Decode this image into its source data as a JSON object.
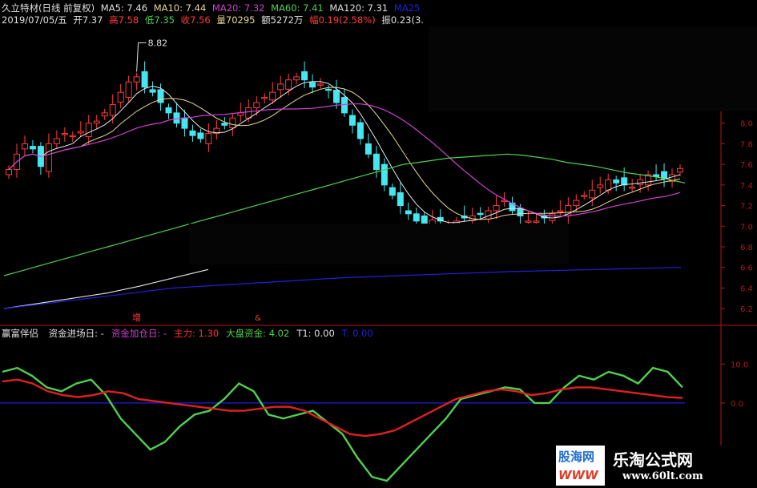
{
  "header": {
    "title": "久立特材(日线 前复权)",
    "ma5": "MA5: 7.46",
    "ma10": "MA10: 7.44",
    "ma20": "MA20: 7.32",
    "ma60": "MA60: 7.41",
    "ma120": "MA120: 7.31",
    "ma250": "MA25",
    "date": "2019/07/05/五",
    "open": "开7.37",
    "high": "高7.58",
    "low": "低7.35",
    "close": "收7.56",
    "volume": "量70295",
    "amount": "额5272万",
    "change": "幅0.19(2.58%)",
    "amplitude": "振0.23(3."
  },
  "colors": {
    "up": "#ff3c3c",
    "down": "#46e6f0",
    "ma5": "#e8e8e8",
    "ma10": "#e8d890",
    "ma20": "#d040d0",
    "ma60": "#50d050",
    "ma120": "#e0e0e0",
    "ma250": "#2020e0",
    "axis": "#b01818"
  },
  "chart_data": [
    {
      "type": "candlestick",
      "title": "久立特材(日线 前复权)",
      "ylim": [
        6.1,
        8.9
      ],
      "yticks": [
        "8.0",
        "7.8",
        "7.6",
        "7.4",
        "7.2",
        "7.0",
        "6.8",
        "6.6",
        "6.4",
        "6.2"
      ],
      "annotation_high": "8.82",
      "markers": [
        "增",
        "&"
      ],
      "series_close": [
        7.55,
        7.7,
        7.8,
        7.75,
        7.58,
        7.8,
        7.85,
        7.9,
        7.88,
        7.92,
        8.0,
        8.02,
        8.1,
        8.18,
        8.3,
        8.4,
        8.45,
        8.35,
        8.3,
        8.2,
        8.1,
        8.0,
        7.95,
        7.88,
        7.85,
        7.9,
        7.95,
        7.98,
        8.05,
        8.1,
        8.15,
        8.2,
        8.25,
        8.3,
        8.38,
        8.42,
        8.45,
        8.42,
        8.35,
        8.38,
        8.32,
        8.2,
        8.1,
        7.98,
        7.85,
        7.7,
        7.55,
        7.4,
        7.3,
        7.2,
        7.12,
        7.05,
        7.02,
        7.06,
        7.05,
        7.0,
        7.05,
        7.08,
        7.1,
        7.12,
        7.15,
        7.2,
        7.25,
        7.15,
        7.1,
        7.05,
        7.05,
        7.08,
        7.12,
        7.15,
        7.2,
        7.25,
        7.3,
        7.35,
        7.4,
        7.45,
        7.42,
        7.4,
        7.38,
        7.45,
        7.5,
        7.48,
        7.46,
        7.5,
        7.56
      ],
      "ma60": [
        6.52,
        6.56,
        6.6,
        6.64,
        6.68,
        6.72,
        6.76,
        6.8,
        6.84,
        6.88,
        6.92,
        6.96,
        7.0,
        7.04,
        7.08,
        7.12,
        7.16,
        7.2,
        7.24,
        7.28,
        7.32,
        7.36,
        7.4,
        7.44,
        7.48,
        7.52,
        7.56,
        7.6,
        7.62,
        7.64,
        7.66,
        7.67,
        7.68,
        7.69,
        7.7,
        7.69,
        7.67,
        7.65,
        7.62,
        7.6,
        7.58,
        7.55,
        7.52,
        7.5,
        7.48,
        7.45,
        7.42
      ],
      "ma120": [
        6.2,
        6.25,
        6.3,
        6.35,
        6.42,
        6.5,
        6.58
      ],
      "ma250": [
        6.2,
        6.3,
        6.4,
        6.45,
        6.5,
        6.53,
        6.56,
        6.58,
        6.6
      ]
    },
    {
      "type": "line",
      "title": "赢富伴侣",
      "legend": [
        {
          "name": "资金进场日:",
          "value": "-",
          "color": "#e0e0e0"
        },
        {
          "name": "资金加仓日:",
          "value": "-",
          "color": "#d040d0"
        },
        {
          "name": "主力:",
          "value": "1.30",
          "color": "#ff3030"
        },
        {
          "name": "大盘资金:",
          "value": "4.02",
          "color": "#50d050"
        },
        {
          "name": "T1:",
          "value": "0.00",
          "color": "#e0e0e0"
        },
        {
          "name": "T:",
          "value": "0.00",
          "color": "#2020e0"
        }
      ],
      "ylim": [
        -20,
        15
      ],
      "yticks": [
        "10.0",
        "0.0"
      ],
      "series": [
        {
          "name": "主力",
          "values": [
            5.5,
            6,
            5,
            3,
            2,
            1.5,
            2,
            3,
            2.5,
            1,
            0.5,
            0,
            -0.5,
            -1,
            -1.5,
            -2,
            -2,
            -1.5,
            -1,
            -1,
            -2,
            -4,
            -6,
            -8,
            -8.5,
            -8,
            -7,
            -5,
            -3,
            -1,
            1,
            2,
            3,
            3.5,
            3,
            2,
            2.5,
            3.5,
            4,
            4,
            3.5,
            3,
            2.5,
            2,
            1.5,
            1.3
          ]
        },
        {
          "name": "大盘资金",
          "values": [
            8,
            9,
            7,
            4,
            3,
            5,
            6,
            2,
            -4,
            -8,
            -12,
            -10,
            -6,
            -3,
            -2,
            1,
            5,
            3,
            -3,
            -4,
            -3,
            -2,
            -5,
            -8,
            -14,
            -19,
            -20,
            -16,
            -12,
            -8,
            -4,
            1,
            2,
            3,
            4,
            3.5,
            0,
            0,
            4,
            7,
            6,
            8,
            7,
            5,
            9,
            8,
            4
          ]
        },
        {
          "name": "T",
          "values": [
            0,
            0
          ]
        }
      ]
    }
  ],
  "indicator_title": "赢富伴侣",
  "watermark": {
    "logo_top": "股海网",
    "logo_bottom": "WWW",
    "site_name": "乐淘公式网",
    "site_url": "www.60lt.com"
  }
}
